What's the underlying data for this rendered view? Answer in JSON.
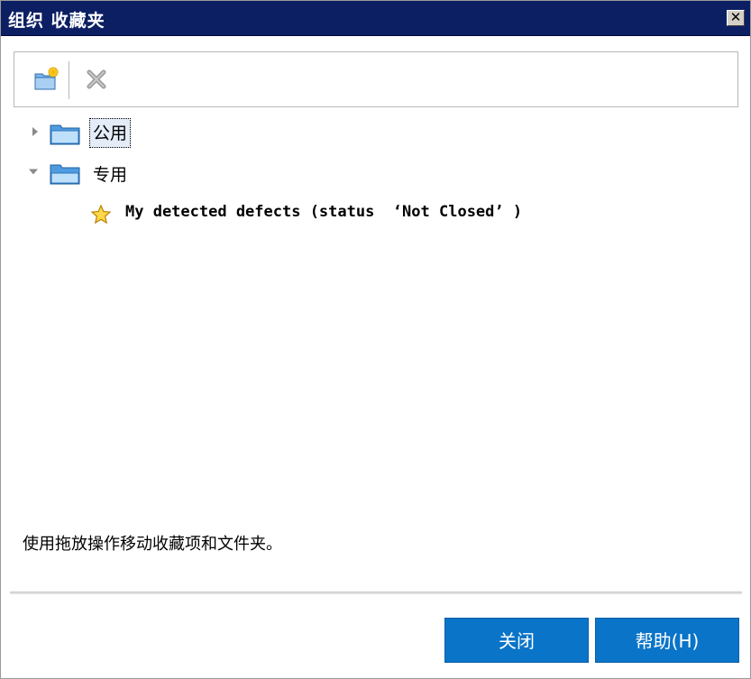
{
  "window": {
    "title": "组织 收藏夹",
    "close_glyph": "✕"
  },
  "toolbar": {
    "new_folder_icon": "new-folder-icon",
    "delete_icon": "delete-icon"
  },
  "tree": {
    "nodes": [
      {
        "label": "公用",
        "expanded": false,
        "selected": true
      },
      {
        "label": "专用",
        "expanded": true,
        "selected": false,
        "children": [
          {
            "label": "My detected defects (status  ‘Not Closed’ )"
          }
        ]
      }
    ]
  },
  "hint": "使用拖放操作移动收藏项和文件夹。",
  "buttons": {
    "close_label": "关闭",
    "help_label": "帮助(H)"
  },
  "colors": {
    "titlebar": "#0c1f63",
    "button": "#0a74c8",
    "selection": "#e3ecf7"
  }
}
